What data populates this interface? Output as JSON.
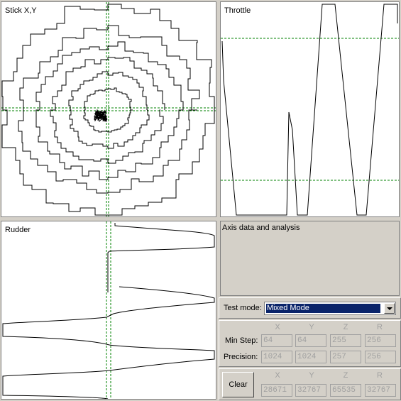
{
  "panels": {
    "stick": {
      "title": "Stick X,Y"
    },
    "throttle": {
      "title": "Throttle"
    },
    "rudder": {
      "title": "Rudder"
    }
  },
  "analysis": {
    "title": "Axis data and analysis",
    "test_mode_label": "Test mode:",
    "test_mode_value": "Mixed Mode",
    "columns": [
      "X",
      "Y",
      "Z",
      "R"
    ],
    "min_step_label": "Min Step:",
    "min_step": [
      "64",
      "64",
      "255",
      "256"
    ],
    "precision_label": "Precision:",
    "precision": [
      "1024",
      "1024",
      "257",
      "256"
    ],
    "clear_label": "Clear",
    "current": [
      "28671",
      "32767",
      "65535",
      "32767"
    ]
  },
  "colors": {
    "guide": "#008000",
    "trace": "#000000",
    "selection": "#0a246a"
  }
}
